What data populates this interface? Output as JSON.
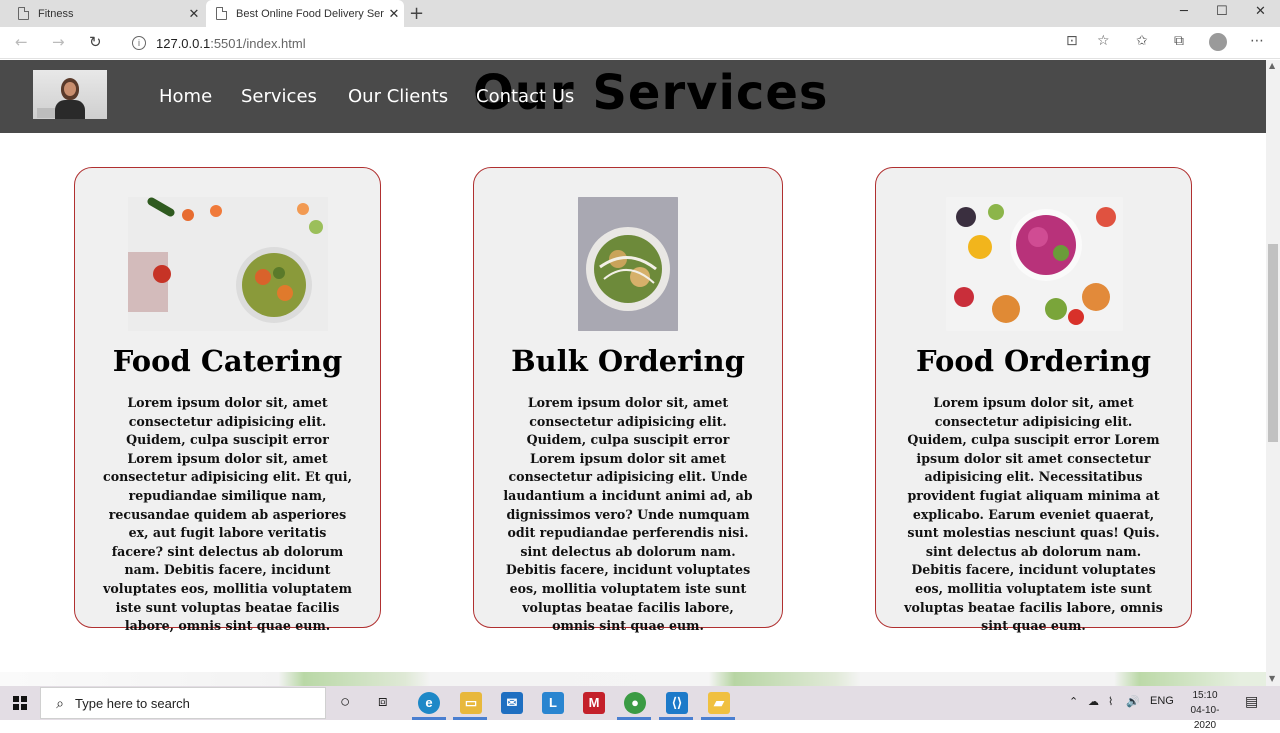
{
  "browser": {
    "tabs": [
      {
        "title": "Fitness"
      },
      {
        "title": "Best Online Food Delivery Servic"
      }
    ],
    "url_host": "127.0.0.1",
    "url_path": ":5501/index.html"
  },
  "site": {
    "nav": [
      "Home",
      "Services",
      "Our Clients",
      "Contact Us"
    ],
    "section_title": "Our Services",
    "cards": [
      {
        "title": "Food Catering",
        "text": "Lorem ipsum dolor sit, amet consectetur adipisicing elit. Quidem, culpa suscipit error Lorem ipsum dolor sit, amet consectetur adipisicing elit. Et qui, repudiandae similique nam, recusandae quidem ab asperiores ex, aut fugit labore veritatis facere? sint delectus ab dolorum nam. Debitis facere, incidunt voluptates eos, mollitia voluptatem iste sunt voluptas beatae facilis labore, omnis sint quae eum."
      },
      {
        "title": "Bulk Ordering",
        "text": "Lorem ipsum dolor sit, amet consectetur adipisicing elit. Quidem, culpa suscipit error Lorem ipsum dolor sit amet consectetur adipisicing elit. Unde laudantium a incidunt animi ad, ab dignissimos vero? Unde numquam odit repudiandae perferendis nisi. sint delectus ab dolorum nam. Debitis facere, incidunt voluptates eos, mollitia voluptatem iste sunt voluptas beatae facilis labore, omnis sint quae eum."
      },
      {
        "title": "Food Ordering",
        "text": "Lorem ipsum dolor sit, amet consectetur adipisicing elit. Quidem, culpa suscipit error Lorem ipsum dolor sit amet consectetur adipisicing elit. Necessitatibus provident fugiat aliquam minima at explicabo. Earum eveniet quaerat, sunt molestias nesciunt quas! Quis. sint delectus ab dolorum nam. Debitis facere, incidunt voluptates eos, mollitia voluptatem iste sunt voluptas beatae facilis labore, omnis sint quae eum."
      }
    ]
  },
  "taskbar": {
    "search_placeholder": "Type here to search",
    "language": "ENG",
    "time": "15:10",
    "date": "04-10-2020",
    "pinned": [
      "edge-icon",
      "file-explorer-icon",
      "mail-icon",
      "l-app-icon",
      "mcafee-icon",
      "chrome-icon",
      "vscode-icon",
      "sticky-folder-icon"
    ]
  }
}
